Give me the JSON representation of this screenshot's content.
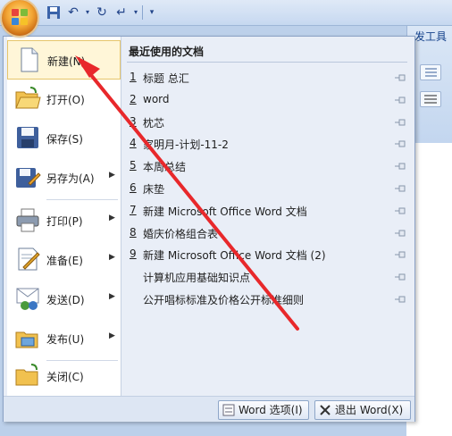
{
  "window": {
    "ribbon_tab_partial": "发工具"
  },
  "quick_access": {
    "icons": [
      "office-button",
      "save-icon",
      "undo-icon",
      "redo-icon",
      "repeat-icon",
      "customize-dropdown-icon"
    ]
  },
  "menu": {
    "items": [
      {
        "label": "新建(N)",
        "icon": "new-document-icon",
        "has_submenu": false
      },
      {
        "label": "打开(O)",
        "icon": "open-folder-icon",
        "has_submenu": false
      },
      {
        "label": "保存(S)",
        "icon": "save-disk-icon",
        "has_submenu": false
      },
      {
        "label": "另存为(A)",
        "icon": "save-as-icon",
        "has_submenu": true
      },
      {
        "label": "打印(P)",
        "icon": "printer-icon",
        "has_submenu": true
      },
      {
        "label": "准备(E)",
        "icon": "prepare-icon",
        "has_submenu": true
      },
      {
        "label": "发送(D)",
        "icon": "send-icon",
        "has_submenu": true
      },
      {
        "label": "发布(U)",
        "icon": "publish-icon",
        "has_submenu": true
      },
      {
        "label": "关闭(C)",
        "icon": "close-folder-icon",
        "has_submenu": false
      }
    ],
    "recent_title": "最近使用的文档",
    "recent": [
      {
        "num": "1",
        "name": "标题 总汇"
      },
      {
        "num": "2",
        "name": "word"
      },
      {
        "num": "3",
        "name": "枕芯"
      },
      {
        "num": "4",
        "name": "家明月-计划-11-2"
      },
      {
        "num": "5",
        "name": "本周总结"
      },
      {
        "num": "6",
        "name": "床垫"
      },
      {
        "num": "7",
        "name": "新建 Microsoft Office Word 文档"
      },
      {
        "num": "8",
        "name": "婚庆价格组合表"
      },
      {
        "num": "9",
        "name": "新建 Microsoft Office Word 文档 (2)"
      },
      {
        "num": "",
        "name": "计算机应用基础知识点"
      },
      {
        "num": "",
        "name": "公开唱标标准及价格公开标准细则"
      }
    ],
    "word_options": "Word 选项(I)",
    "exit_word": "退出 Word(X)"
  },
  "colors": {
    "annotation_arrow": "#e8282b",
    "menu_background": "#e9eef7",
    "highlight": "#fff6d8"
  }
}
